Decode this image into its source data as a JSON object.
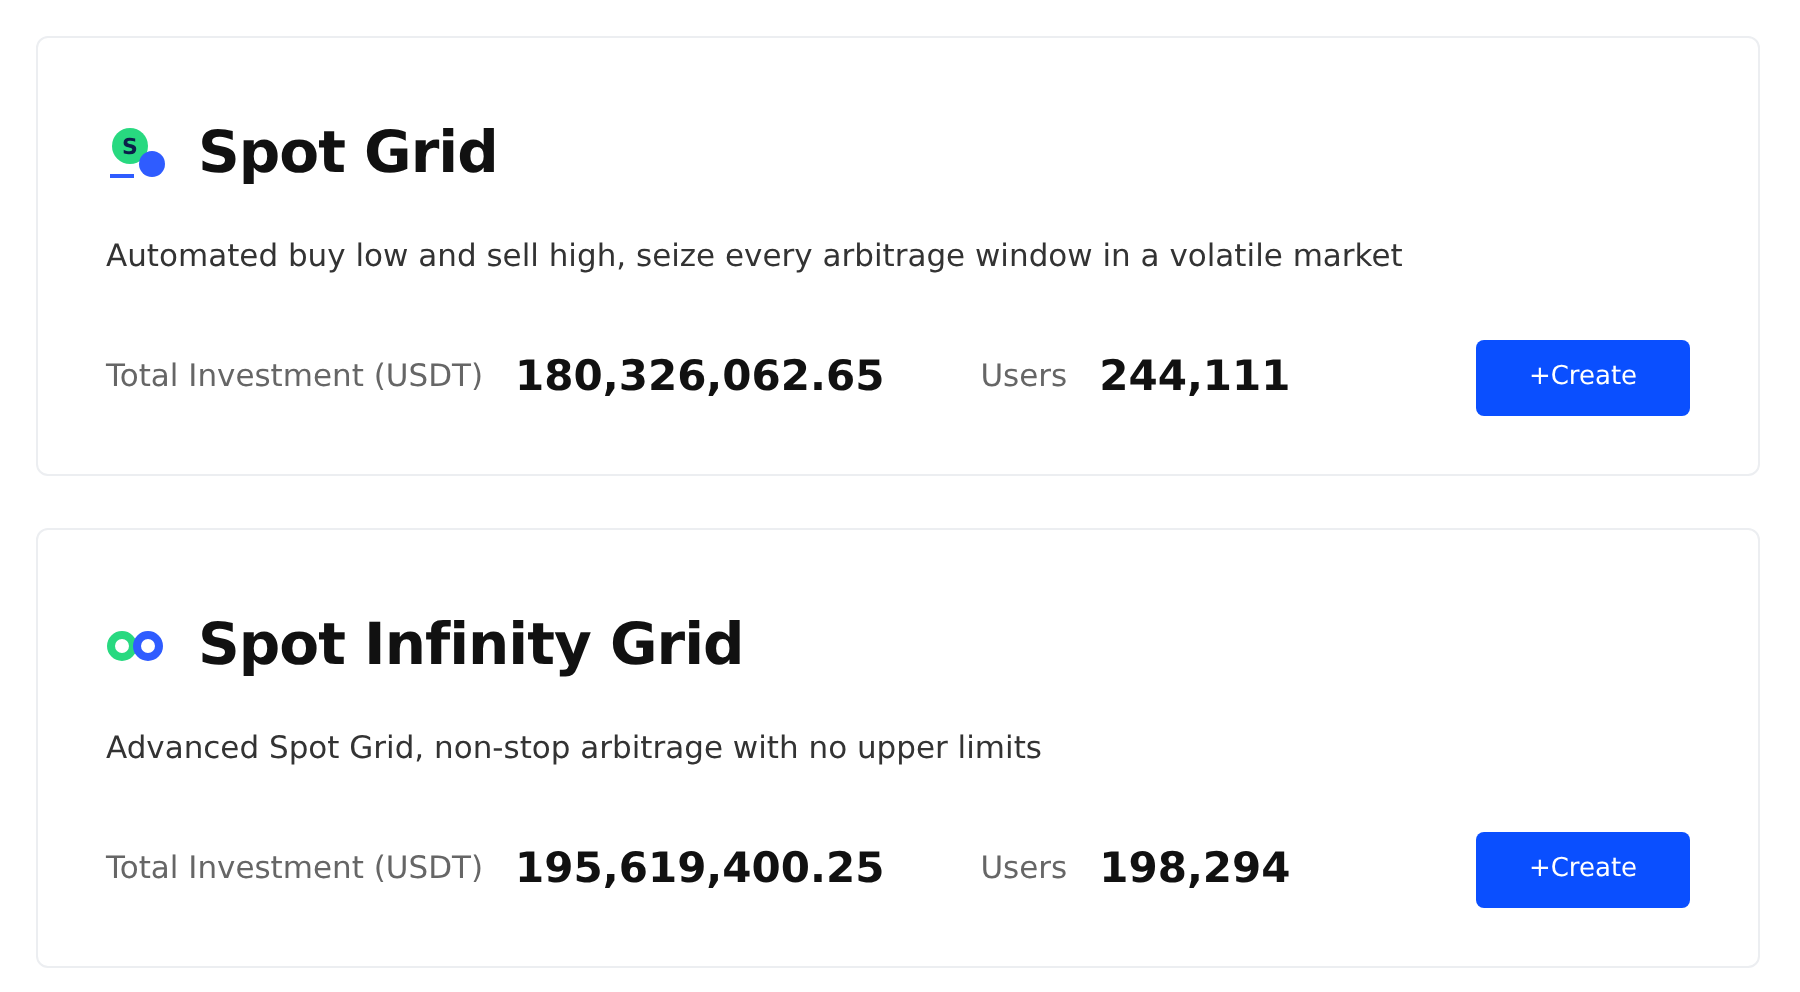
{
  "products": [
    {
      "kind": "grid",
      "icon_letter": "S",
      "title": "Spot Grid",
      "description": "Automated buy low and sell high, seize every arbitrage window in a volatile market",
      "investment_label": "Total Investment (USDT)",
      "investment": "180,326,062.65",
      "users_label": "Users",
      "users": "244,111",
      "button": "+Create"
    },
    {
      "kind": "infinity",
      "title": "Spot Infinity Grid",
      "description": "Advanced Spot Grid, non-stop arbitrage with no upper limits",
      "investment_label": "Total Investment (USDT)",
      "investment": "195,619,400.25",
      "users_label": "Users",
      "users": "198,294",
      "button": "+Create"
    }
  ]
}
